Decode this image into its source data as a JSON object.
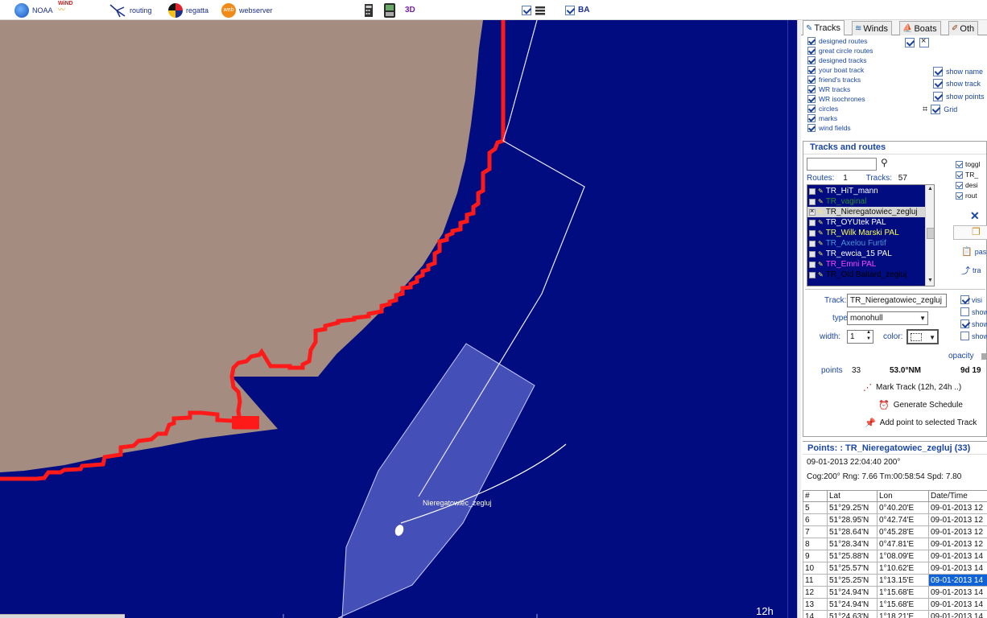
{
  "toolbar": {
    "noaa": "NOAA",
    "wind_logo": "WiND",
    "routing": "routing",
    "regatta": "regatta",
    "web_logo": "web",
    "webserver": "webserver",
    "three_d": "3D",
    "ba": "BA",
    "icons": [
      "noaa-globe-icon",
      "wind-logo-icon",
      "routing-icon",
      "regatta-compass-icon",
      "webserver-icon",
      "calculator-icon",
      "device-icon",
      "layers-icon"
    ]
  },
  "map": {
    "boat_label": "Nieregatowiec_zegluj",
    "time_label": "12h",
    "colors": {
      "sea": "#000c80",
      "land": "#a48c80",
      "track": "#ff1a1a",
      "route": "#e8e8ff",
      "boat_fill": "#5963c8"
    }
  },
  "tabs": [
    "Tracks",
    "Winds",
    "Boats",
    "Oth"
  ],
  "layers": {
    "items": [
      "designed  routes",
      "great circle routes",
      "designed  tracks",
      "your boat track",
      "friend's tracks",
      "WR tracks",
      "WR isochrones",
      "circles",
      "marks",
      "wind fields"
    ],
    "right": [
      "show name",
      "show track",
      "show points",
      "Grid"
    ]
  },
  "tracks": {
    "title": "Tracks and routes",
    "routes_label": "Routes:",
    "routes_count": "1",
    "tracks_label": "Tracks:",
    "tracks_count": "57",
    "list": [
      {
        "name": "TR_HiT_mann",
        "color": "#ffffff",
        "selected": false,
        "checked": false
      },
      {
        "name": "TR_vaginal",
        "color": "#2e8b2e",
        "selected": false,
        "checked": false
      },
      {
        "name": "TR_Nieregatowiec_zegluj",
        "color": "#ffffff",
        "selected": true,
        "checked": true
      },
      {
        "name": "TR_OYUtek PAL",
        "color": "#ffffff",
        "selected": false,
        "checked": false
      },
      {
        "name": "TR_Wilk Marski PAL",
        "color": "#ffff55",
        "selected": false,
        "checked": false
      },
      {
        "name": "TR_Axelou Furtif",
        "color": "#4f95d8",
        "selected": false,
        "checked": false
      },
      {
        "name": "TR_ewcia_15 PAL",
        "color": "#ffffff",
        "selected": false,
        "checked": false
      },
      {
        "name": "TR_Emni PAL",
        "color": "#ff44ff",
        "selected": false,
        "checked": false
      },
      {
        "name": "TR_Old Baltard_zegluj",
        "color": "#000000",
        "selected": false,
        "checked": false
      }
    ],
    "mini_options": [
      "toggl",
      "TR_",
      "desi",
      "rout"
    ],
    "side_actions": [
      "pas",
      "tra"
    ],
    "track_label": "Track:",
    "track_value": "TR_Nieregatowiec_zegluj",
    "type_label": "type:",
    "type_value": "monohull",
    "width_label": "width:",
    "width_value": "1",
    "color_label": "color:",
    "props_right": [
      "visi",
      "show",
      "show",
      "show"
    ],
    "opacity_label": "opacity",
    "points_label": "points",
    "points_value": "33",
    "distance": "53.0°NM",
    "duration": "9d 19",
    "mark_track": "Mark Track (12h, 24h ..)",
    "generate_schedule": "Generate Schedule",
    "add_point": "Add point to selected Track"
  },
  "points": {
    "header": "Points: : TR_Nieregatowiec_zegluj (33)",
    "line1": "09-01-2013 22:04:40 200°",
    "line2": "Cog:200° Rng:  7.66 Tm:00:58:54 Spd:  7.80",
    "columns": [
      "#",
      "Lat",
      "Lon",
      "Date/Time"
    ],
    "rows": [
      [
        "5",
        "51°29.25'N",
        "0°40.20'E",
        "09-01-2013 12"
      ],
      [
        "6",
        "51°28.95'N",
        "0°42.74'E",
        "09-01-2013 12"
      ],
      [
        "7",
        "51°28.64'N",
        "0°45.28'E",
        "09-01-2013 12"
      ],
      [
        "8",
        "51°28.34'N",
        "0°47.81'E",
        "09-01-2013 12"
      ],
      [
        "9",
        "51°25.88'N",
        "1°08.09'E",
        "09-01-2013 14"
      ],
      [
        "10",
        "51°25.57'N",
        "1°10.62'E",
        "09-01-2013 14"
      ],
      [
        "11",
        "51°25.25'N",
        "1°13.15'E",
        "09-01-2013 14"
      ],
      [
        "12",
        "51°24.94'N",
        "1°15.68'E",
        "09-01-2013 14"
      ],
      [
        "13",
        "51°24.94'N",
        "1°15.68'E",
        "09-01-2013 14"
      ],
      [
        "14",
        "51°24.63'N",
        "1°18.21'E",
        "09-01-2013 14"
      ]
    ],
    "highlight_row": 6
  }
}
